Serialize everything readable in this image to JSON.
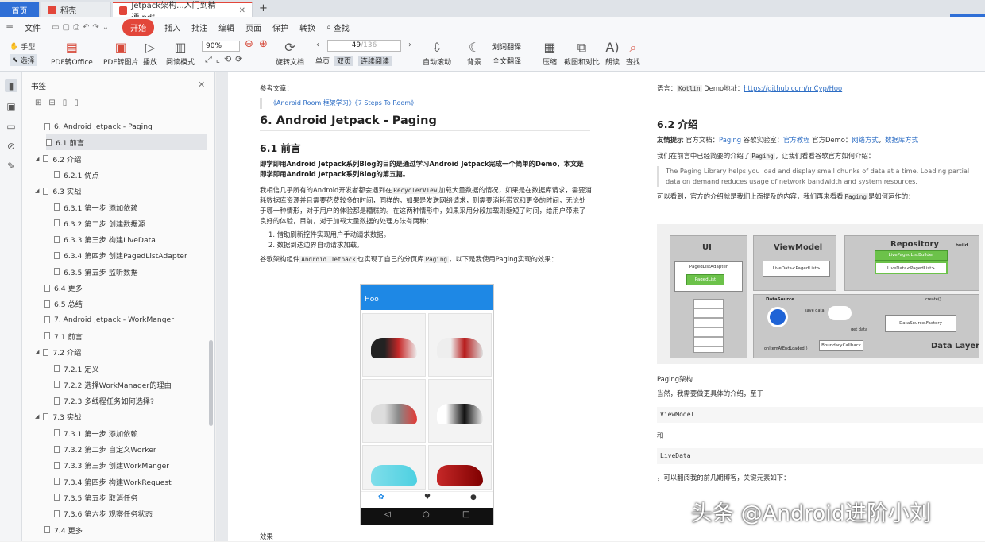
{
  "tabs": {
    "home": "首页",
    "t2": "稻壳",
    "t3": "Jetpack架构...入门到精通.pdf"
  },
  "menu": [
    "文件",
    "开始",
    "插入",
    "批注",
    "编辑",
    "页面",
    "保护",
    "转换"
  ],
  "menu_search": "查找",
  "toolbar": {
    "hand": "手型",
    "select": "选择",
    "pdf_office": "PDF转Office",
    "pdf_image": "PDF转图片",
    "play": "播放",
    "read_mode": "阅读模式",
    "zoom": "90%",
    "rotate": "旋转文档",
    "single": "单页",
    "double": "双页",
    "continuous": "连续阅读",
    "page_current": "49",
    "page_total": "/136",
    "autoscroll": "自动滚动",
    "background": "背景",
    "word_translate": "划词翻译",
    "full_translate": "全文翻译",
    "compress": "压缩",
    "screenshot": "截图和对比",
    "read_aloud": "朗读",
    "find": "查找"
  },
  "panel": {
    "title": "书签"
  },
  "bookmarks": [
    {
      "label": "6. Android Jetpack - Paging",
      "level": 1
    },
    {
      "label": "6.1 前言",
      "level": 1,
      "selected": true
    },
    {
      "label": "6.2 介绍",
      "level": 1,
      "expand": true
    },
    {
      "label": "6.2.1 优点",
      "level": 2
    },
    {
      "label": "6.3 实战",
      "level": 1,
      "expand": true
    },
    {
      "label": "6.3.1 第一步 添加依赖",
      "level": 2
    },
    {
      "label": "6.3.2 第二步 创建数据源",
      "level": 2
    },
    {
      "label": "6.3.3 第三步 构建LiveData",
      "level": 2
    },
    {
      "label": "6.3.4 第四步 创建PagedListAdapter",
      "level": 2
    },
    {
      "label": "6.3.5 第五步 监听数据",
      "level": 2
    },
    {
      "label": "6.4 更多",
      "level": 1
    },
    {
      "label": "6.5 总结",
      "level": 1
    },
    {
      "label": "7. Android Jetpack - WorkManger",
      "level": 1
    },
    {
      "label": "7.1 前言",
      "level": 1
    },
    {
      "label": "7.2 介绍",
      "level": 1,
      "expand": true
    },
    {
      "label": "7.2.1 定义",
      "level": 2
    },
    {
      "label": "7.2.2 选择WorkManager的理由",
      "level": 2
    },
    {
      "label": "7.2.3 多线程任务如何选择?",
      "level": 2
    },
    {
      "label": "7.3 实战",
      "level": 1,
      "expand": true
    },
    {
      "label": "7.3.1 第一步 添加依赖",
      "level": 2
    },
    {
      "label": "7.3.2 第二步 自定义Worker",
      "level": 2
    },
    {
      "label": "7.3.3 第三步 创建WorkManger",
      "level": 2
    },
    {
      "label": "7.3.4 第四步 构建WorkRequest",
      "level": 2
    },
    {
      "label": "7.3.5 第五步 取消任务",
      "level": 2
    },
    {
      "label": "7.3.6 第六步 观察任务状态",
      "level": 2
    },
    {
      "label": "7.4 更多",
      "level": 1
    }
  ],
  "left_page": {
    "ref_label": "参考文章：",
    "ref_links": "《Android Room 框架学习》《7 Steps To Room》",
    "h1": "6. Android Jetpack - Paging",
    "h2": "6.1 前言",
    "intro": "即学即用Android Jetpack系列Blog的目的是通过学习Android Jetpack完成一个简单的Demo，本文是即学即用Android Jetpack系列Blog的第五篇。",
    "para1a": "我相信几乎所有的Android开发者都会遇到在",
    "para1code": "RecyclerView",
    "para1b": "加载大量数据的情况，如果是在数据库请求，需要消耗数据库资源并且需要花费较多的时间，同样的，如果是发送网络请求，则需要消耗带宽和更多的时间，无论处于哪一种情形，对于用户的体验都是糟糕的。在这两种情形中，如果采用分段加载则缩短了时间，给用户带来了良好的体验，目前，对于加载大量数据的处理方法有两种：",
    "li1": "1. 借助刷新控件实现用户手动请求数据。",
    "li2": "2. 数据到达边界自动请求加载。",
    "para2a": "谷歌架构组件",
    "para2code1": "Android Jetpack",
    "para2b": "也实现了自己的分页库",
    "para2code2": "Paging",
    "para2c": "，以下是我使用Paging实现的效果：",
    "phone_title": "Hoo",
    "caption": "效果"
  },
  "right_page": {
    "lang_a": "语言：",
    "lang_code": "Kotlin",
    "lang_b": "Demo地址：",
    "lang_link": "https://github.com/mCyp/Hoo",
    "h2": "6.2 介绍",
    "tip_label": "友情提示",
    "tip_a": "官方文档：",
    "tip_l1": "Paging",
    "tip_b": "谷歌实验室：",
    "tip_l2": "官方教程",
    "tip_c": "官方Demo：",
    "tip_l3": "网络方式",
    "tip_d": "，",
    "tip_l4": "数据库方式",
    "para1a": "我们在前言中已经简要的介绍了",
    "para1code": "Paging",
    "para1b": "，让我们看看谷歌官方如何介绍：",
    "quote": "The Paging Library helps you load and display small chunks of data at a time. Loading partial data on demand reduces usage of network bandwidth and system resources.",
    "para2a": "可以看到，官方的介绍就是我们上面提及的内容，我们再来看看",
    "para2code": "Paging",
    "para2b": "是如何运作的：",
    "diagram": {
      "ui": "UI",
      "viewmodel": "ViewModel",
      "repository": "Repository",
      "datalayer": "Data Layer",
      "paged_adapter": "PagedListAdapter",
      "paged_list": "PagedList",
      "livedata_vm": "LiveData<PagedList>",
      "builder": "LivePagedListBuilder",
      "livedata_repo": "LiveData<PagedList>",
      "build": "build",
      "datasource": "DataSource",
      "save": "save data",
      "get": "get data",
      "create": "create()",
      "factory": "DataSource.Factory",
      "boundary": "BoundaryCallback",
      "onitem": "onItemAtEndLoaded()"
    },
    "caption": "Paging架构",
    "para3": "当然，我需要做更具体的介绍，至于",
    "code1": "ViewModel",
    "and": "和",
    "code2": "LiveData",
    "para4": "，可以翻阅我的前几期博客，关键元素如下："
  },
  "watermark": "头条 @Android进阶小刘"
}
